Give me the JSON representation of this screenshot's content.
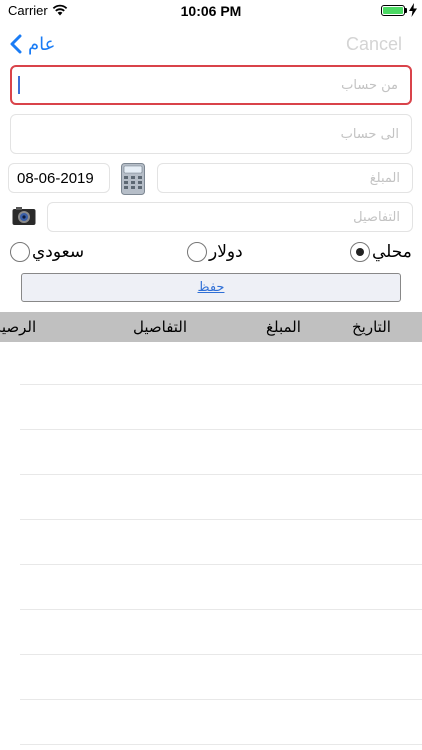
{
  "status_bar": {
    "carrier": "Carrier",
    "time": "10:06 PM"
  },
  "nav": {
    "back_label": "عام",
    "cancel_label": "Cancel"
  },
  "form": {
    "from_account_placeholder": "من حساب",
    "to_account_placeholder": "الى حساب",
    "date_value": "08-06-2019",
    "amount_placeholder": "المبلغ",
    "details_placeholder": "التفاصيل"
  },
  "currency": {
    "options": [
      {
        "label": "محلي",
        "selected": true
      },
      {
        "label": "دولار",
        "selected": false
      },
      {
        "label": "سعودي",
        "selected": false
      }
    ]
  },
  "save_label": "حفظ",
  "table": {
    "columns": [
      "التاريخ",
      "المبلغ",
      "التفاصيل",
      "الرصيد"
    ],
    "header_bg": "#c0c0c0"
  },
  "colors": {
    "accent": "#1a7cf5",
    "focus_border": "#d9434a",
    "battery": "#4cd964"
  }
}
